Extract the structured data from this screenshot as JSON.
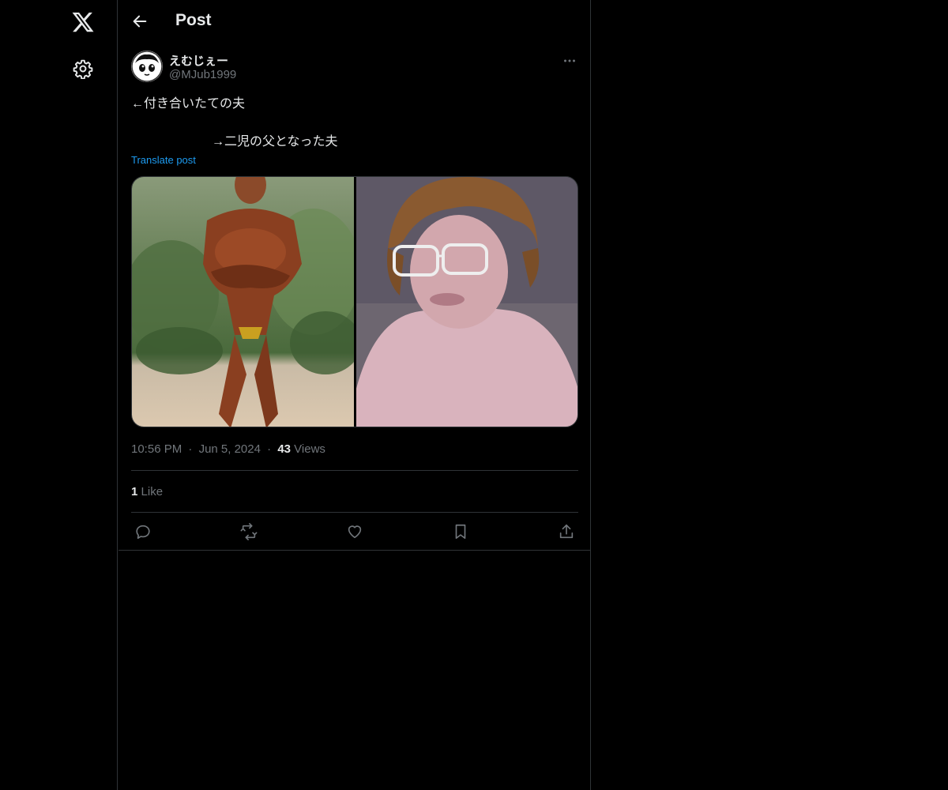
{
  "icons": {
    "logo": "x-logo-icon",
    "settings": "gear-icon",
    "back": "arrow-left-icon",
    "more": "more-horizontal-icon",
    "reply": "reply-icon",
    "repost": "repost-icon",
    "like": "heart-icon",
    "bookmark": "bookmark-icon",
    "share": "share-icon"
  },
  "header": {
    "title": "Post"
  },
  "post": {
    "author": {
      "name": "えむじぇー",
      "handle": "@MJub1999"
    },
    "text_line1": "←付き合いたての夫",
    "text_line2": "→二児の父となった夫",
    "translate_label": "Translate post",
    "time": "10:56 PM",
    "date": "Jun 5, 2024",
    "views_count": "43",
    "views_label": "Views",
    "likes_count": "1",
    "likes_label": "Like",
    "separator": "·"
  },
  "colors": {
    "background": "#000000",
    "border": "#2f3336",
    "text_primary": "#e7e9ea",
    "text_secondary": "#71767b",
    "link": "#1d9bf0"
  }
}
